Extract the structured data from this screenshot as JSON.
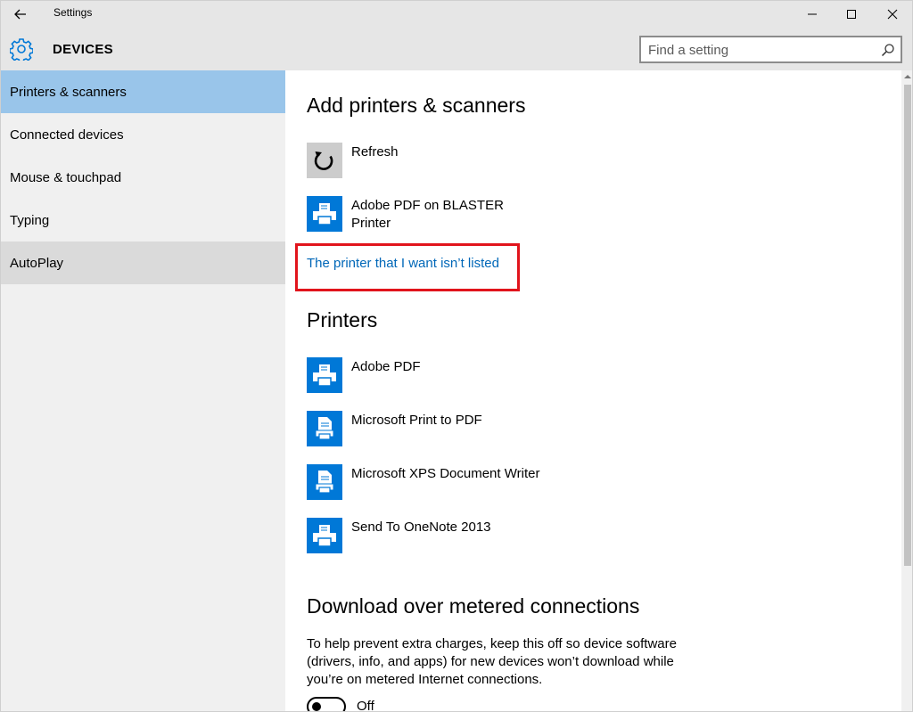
{
  "window": {
    "title": "Settings"
  },
  "header": {
    "section": "DEVICES"
  },
  "search": {
    "placeholder": "Find a setting"
  },
  "sidebar": {
    "items": [
      {
        "label": "Printers & scanners"
      },
      {
        "label": "Connected devices"
      },
      {
        "label": "Mouse & touchpad"
      },
      {
        "label": "Typing"
      },
      {
        "label": "AutoPlay"
      }
    ]
  },
  "add_section": {
    "heading": "Add printers & scanners",
    "refresh_label": "Refresh",
    "found_device_line1": "Adobe PDF on BLASTER",
    "found_device_line2": "Printer",
    "not_listed_link": "The printer that I want isn’t listed"
  },
  "printers_section": {
    "heading": "Printers",
    "items": [
      {
        "label": "Adobe PDF",
        "icon": "printer-icon"
      },
      {
        "label": "Microsoft Print to PDF",
        "icon": "document-printer-icon"
      },
      {
        "label": "Microsoft XPS Document Writer",
        "icon": "document-printer-icon"
      },
      {
        "label": "Send To OneNote 2013",
        "icon": "printer-icon"
      }
    ]
  },
  "metered_section": {
    "heading": "Download over metered connections",
    "description": "To help prevent extra charges, keep this off so device software (drivers, info, and apps) for new devices won’t download while you’re on metered Internet connections.",
    "toggle_state": "Off"
  },
  "colors": {
    "accent": "#0078d7",
    "selected": "#99c5ea",
    "link": "#0067b8",
    "highlight": "#e1141c"
  }
}
